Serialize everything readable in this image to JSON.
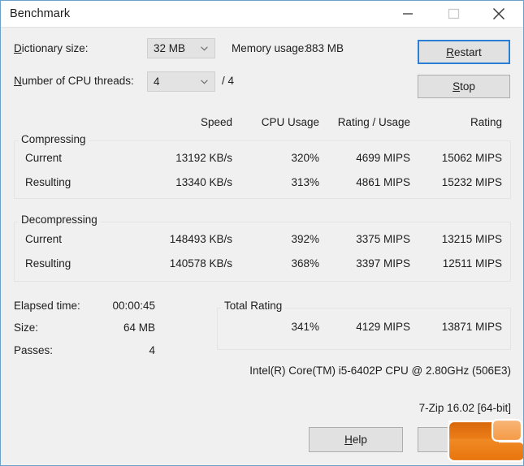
{
  "window": {
    "title": "Benchmark",
    "caption_buttons": [
      {
        "name": "minimize",
        "glyph": "minimize-icon"
      },
      {
        "name": "maximize",
        "glyph": "maximize-icon"
      },
      {
        "name": "close",
        "glyph": "close-icon"
      }
    ]
  },
  "settings": {
    "dictionary_label": "Dictionary size:",
    "dictionary_accel": "D",
    "dictionary_value": "32 MB",
    "threads_label": "Number of CPU threads:",
    "threads_accel": "N",
    "threads_value": "4",
    "threads_max": "/ 4",
    "memory_label": "Memory usage:",
    "memory_value": "883 MB"
  },
  "actions": {
    "restart": "Restart",
    "restart_accel": "R",
    "stop": "Stop",
    "stop_accel": "S",
    "help": "Help",
    "help_accel": "H",
    "close": ""
  },
  "table": {
    "columns": [
      "Speed",
      "CPU Usage",
      "Rating / Usage",
      "Rating"
    ],
    "groups": [
      {
        "title": "Compressing",
        "rows": [
          {
            "label": "Current",
            "speed": "13192 KB/s",
            "cpu": "320%",
            "rating_usage": "4699 MIPS",
            "rating": "15062 MIPS"
          },
          {
            "label": "Resulting",
            "speed": "13340 KB/s",
            "cpu": "313%",
            "rating_usage": "4861 MIPS",
            "rating": "15232 MIPS"
          }
        ]
      },
      {
        "title": "Decompressing",
        "rows": [
          {
            "label": "Current",
            "speed": "148493 KB/s",
            "cpu": "392%",
            "rating_usage": "3375 MIPS",
            "rating": "13215 MIPS"
          },
          {
            "label": "Resulting",
            "speed": "140578 KB/s",
            "cpu": "368%",
            "rating_usage": "3397 MIPS",
            "rating": "12511 MIPS"
          }
        ]
      }
    ]
  },
  "summary": {
    "elapsed_label": "Elapsed time:",
    "elapsed_value": "00:00:45",
    "size_label": "Size:",
    "size_value": "64 MB",
    "passes_label": "Passes:",
    "passes_value": "4"
  },
  "total_rating": {
    "title": "Total Rating",
    "cpu": "341%",
    "rating_usage": "4129 MIPS",
    "rating": "13871 MIPS"
  },
  "footer": {
    "cpu_info": "Intel(R) Core(TM) i5-6402P CPU @ 2.80GHz (506E3)",
    "version": "7-Zip 16.02 [64-bit]"
  },
  "colors": {
    "window_bg": "#f0f0f0",
    "titlebar_bg": "#ffffff",
    "border": "#6da0c8",
    "focus_ring": "#2a7fd4",
    "logo_orange": "#e8740c",
    "logo_orange_light": "#f7a65a"
  }
}
